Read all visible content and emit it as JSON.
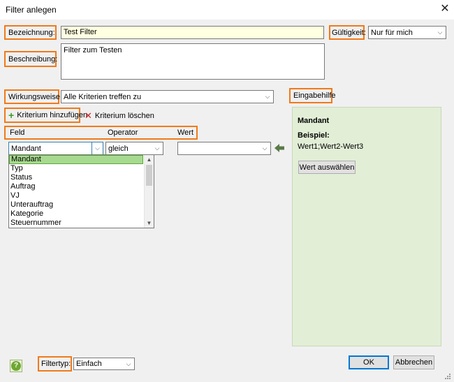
{
  "window": {
    "title": "Filter anlegen",
    "close_glyph": "✕"
  },
  "form": {
    "bezeichnung_label": "Bezeichnung:",
    "bezeichnung_value": "Test Filter",
    "gueltigkeit_label": "Gültigkeit:",
    "gueltigkeit_value": "Nur für mich",
    "beschreibung_label": "Beschreibung:",
    "beschreibung_value": "Filter zum Testen",
    "wirkungsweise_label": "Wirkungsweise:",
    "wirkungsweise_value": "Alle Kriterien treffen zu"
  },
  "criteria": {
    "add_label": "Kriterium hinzufügen",
    "delete_label": "Kriterium löschen",
    "col_feld": "Feld",
    "col_operator": "Operator",
    "col_wert": "Wert",
    "feld_value": "Mandant",
    "operator_value": "gleich",
    "wert_value": "",
    "feld_options": [
      "Mandant",
      "Typ",
      "Status",
      "Auftrag",
      "VJ",
      "Unterauftrag",
      "Kategorie",
      "Steuernummer"
    ]
  },
  "helper": {
    "label": "Eingabehilfe",
    "field_name": "Mandant",
    "example_label": "Beispiel:",
    "example_value": "Wert1;Wert2-Wert3",
    "select_button": "Wert auswählen"
  },
  "footer": {
    "filtertyp_label": "Filtertyp:",
    "filtertyp_value": "Einfach",
    "ok_button": "OK",
    "cancel_button": "Abbrechen"
  },
  "colors": {
    "highlight": "#f07a1a",
    "helper_bg": "#e2eed6",
    "selected_item": "#a8d990",
    "name_field_bg": "#ffffe1"
  }
}
